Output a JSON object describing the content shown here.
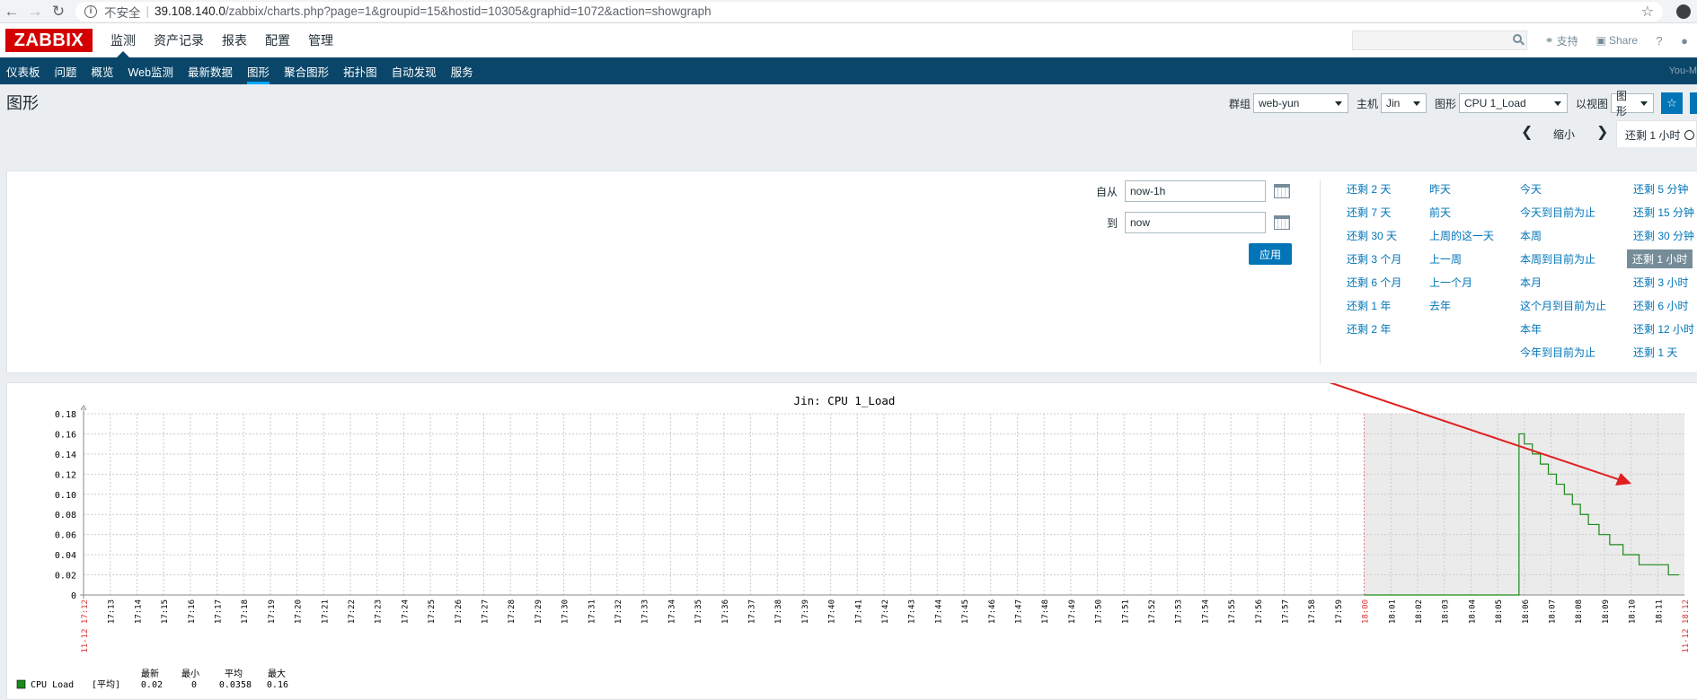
{
  "browser": {
    "insecure_label": "不安全",
    "url_host": "39.108.140.0",
    "url_path": "/zabbix/charts.php?page=1&groupid=15&hostid=10305&graphid=1072&action=showgraph"
  },
  "header": {
    "logo": "ZABBIX",
    "menu": [
      "监测",
      "资产记录",
      "报表",
      "配置",
      "管理"
    ],
    "support": "支持",
    "share": "Share",
    "help": "?"
  },
  "subnav": {
    "items": [
      "仪表板",
      "问题",
      "概览",
      "Web监测",
      "最新数据",
      "图形",
      "聚合图形",
      "拓扑图",
      "自动发现",
      "服务"
    ],
    "user": "You-M"
  },
  "title": {
    "text": "图形",
    "group_label": "群组",
    "group_value": "web-yun",
    "host_label": "主机",
    "host_value": "Jin",
    "graph_label": "图形",
    "graph_value": "CPU 1_Load",
    "view_label": "以视图",
    "view_value": "图形"
  },
  "timetabs": {
    "zoom_out": "缩小",
    "active": "还剩 1 小时"
  },
  "filter": {
    "from_label": "自从",
    "from_value": "now-1h",
    "to_label": "到",
    "to_value": "now",
    "apply": "应用",
    "col1": [
      "还剩 2 天",
      "还剩 7 天",
      "还剩 30 天",
      "还剩 3 个月",
      "还剩 6 个月",
      "还剩 1 年",
      "还剩 2 年"
    ],
    "col2": [
      "昨天",
      "前天",
      "上周的这一天",
      "上一周",
      "上一个月",
      "去年"
    ],
    "col3": [
      "今天",
      "今天到目前为止",
      "本周",
      "本周到目前为止",
      "本月",
      "这个月到目前为止",
      "本年",
      "今年到目前为止"
    ],
    "col4": [
      "还剩 5 分钟",
      "还剩 15 分钟",
      "还剩 30 分钟",
      "还剩 1 小时",
      "还剩 3 小时",
      "还剩 6 小时",
      "还剩 12 小时",
      "还剩 1 天"
    ],
    "col4_selected": 3
  },
  "graph": {
    "title": "Jin: CPU 1_Load",
    "yticks": [
      "0.18",
      "0.16",
      "0.14",
      "0.12",
      "0.10",
      "0.08",
      "0.06",
      "0.04",
      "0.02",
      "0"
    ],
    "ymax": 0.18,
    "start_label": "11-12 17:12",
    "end_label": "11-12 18:12",
    "hour_label": "18:00",
    "legend": {
      "headers": [
        "最新",
        "最小",
        "平均",
        "最大"
      ],
      "name": "CPU Load",
      "func": "[平均]",
      "values": [
        "0.02",
        "0",
        "0.0358",
        "0.16"
      ]
    }
  },
  "chart_data": {
    "type": "line",
    "title": "Jin: CPU 1_Load",
    "series": [
      {
        "name": "CPU Load"
      }
    ],
    "x_minutes_after_1712": [
      48,
      51,
      53.6,
      53.8,
      54,
      54.3,
      54.6,
      54.9,
      55.2,
      55.5,
      55.8,
      56.1,
      56.4,
      56.8,
      57.2,
      57.7,
      58.3,
      58.9,
      59.4,
      59.8
    ],
    "y": [
      0,
      0,
      0,
      0.16,
      0.15,
      0.14,
      0.13,
      0.12,
      0.11,
      0.1,
      0.09,
      0.08,
      0.07,
      0.06,
      0.05,
      0.04,
      0.03,
      0.03,
      0.02,
      0.02
    ],
    "ylim": [
      0,
      0.18
    ],
    "colors": {
      "line": "#1a8a1a",
      "grid": "#cccccc",
      "highlight": "#ebebeb",
      "time_label": "#dc3030"
    }
  }
}
